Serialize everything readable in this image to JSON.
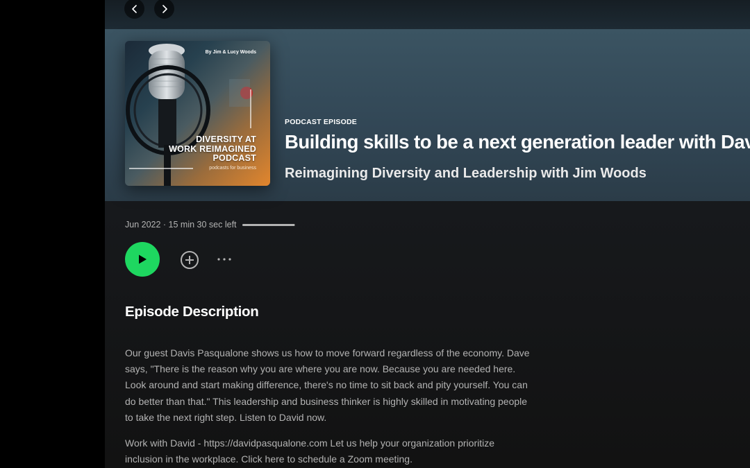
{
  "nav": {
    "back_icon": "chevron-left-icon",
    "forward_icon": "chevron-right-icon"
  },
  "cover": {
    "authors": "By Jim & Lucy Woods",
    "title_line1": "DIVERSITY AT",
    "title_line2": "WORK REIMAGINED",
    "title_line3": "PODCAST",
    "subtitle": "podcasts for business"
  },
  "episode": {
    "type_label": "PODCAST EPISODE",
    "title": "Building skills to be a next generation leader with David",
    "show_name": "Reimagining Diversity and Leadership with Jim Woods",
    "meta": "Jun 2022 · 15 min 30 sec left",
    "progress_fraction": 0.99
  },
  "actions": {
    "play_icon": "play-icon",
    "add_icon": "add-circle-icon",
    "more_icon": "more-options-icon"
  },
  "description": {
    "heading": "Episode Description",
    "paragraph1_line1": "Our guest Davis Pasqualone shows us how to move forward regardless of the economy. Dave",
    "paragraph1_line2": "says, \"There is the reason why you are where you are now. Because you are needed here.",
    "paragraph1_line3": "Look around and start making difference, there's no time to sit back and pity yourself. You can",
    "paragraph1_line4": "do better than that.\" This leadership and business thinker is highly skilled in motivating people",
    "paragraph1_line5": "to take the next right step. Listen to David now.",
    "paragraph2_line1": "Work with David - https://davidpasqualone.com Let us help your organization prioritize",
    "paragraph2_line2": "inclusion in the workplace. Click here to schedule a Zoom meeting."
  },
  "colors": {
    "accent": "#1ed760",
    "header_bg": "#3b5462",
    "text_muted": "#b3b3b3"
  }
}
